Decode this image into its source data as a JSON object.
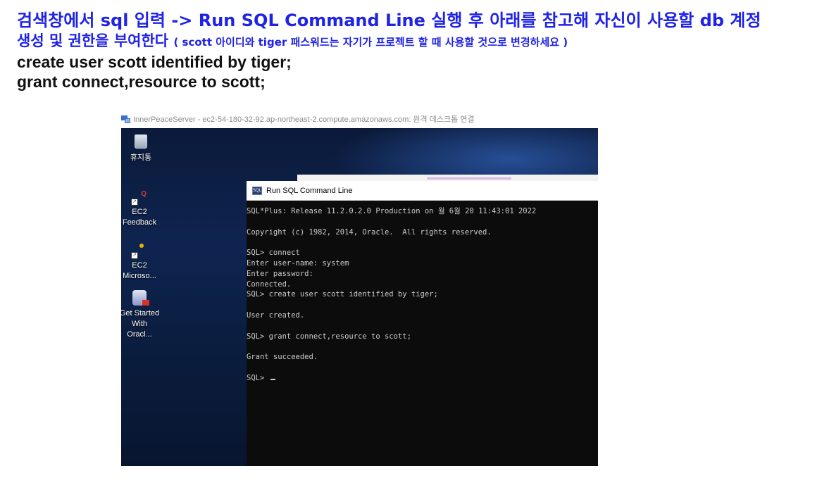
{
  "document": {
    "line1": "검색창에서 sql 입력 -> Run SQL Command Line 실행 후 아래를 참고해 자신이 사용할 db 계정",
    "line2_main": "생성 및 권한을 부여한다",
    "line2_note": "( scott 아이디와  tiger 패스워드는 자기가 프로젝트 할 때 사용할 것으로 변경하세요 )",
    "command1": "create user scott identified by tiger;",
    "command2": "grant connect,resource to scott;"
  },
  "rdp": {
    "title": "InnerPeaceServer - ec2-54-180-32-92.ap-northeast-2.compute.amazonaws.com: 원격 데스크톱 연결",
    "icon": "remote-desktop-icon"
  },
  "desktop": {
    "icons": [
      {
        "name": "recycle-bin-icon",
        "label": "휴지통"
      },
      {
        "name": "ec2-feedback-icon",
        "label": "EC2 Feedback"
      },
      {
        "name": "ec2-microsoft-icon",
        "label": "EC2 Microso..."
      },
      {
        "name": "oracle-get-started-icon",
        "label": "Get Started With Oracl..."
      }
    ]
  },
  "sql_window": {
    "title": "Run SQL Command Line",
    "lines": [
      "SQL*Plus: Release 11.2.0.2.0 Production on 월 6월 20 11:43:01 2022",
      "",
      "Copyright (c) 1982, 2014, Oracle.  All rights reserved.",
      "",
      "SQL> connect",
      "Enter user-name: system",
      "Enter password:",
      "Connected.",
      "SQL> create user scott identified by tiger;",
      "",
      "User created.",
      "",
      "SQL> grant connect,resource to scott;",
      "",
      "Grant succeeded.",
      ""
    ],
    "prompt": "SQL> "
  },
  "colors": {
    "heading_blue": "#1f23e6",
    "console_bg": "#0c0c0c",
    "console_text": "#cccccc"
  }
}
